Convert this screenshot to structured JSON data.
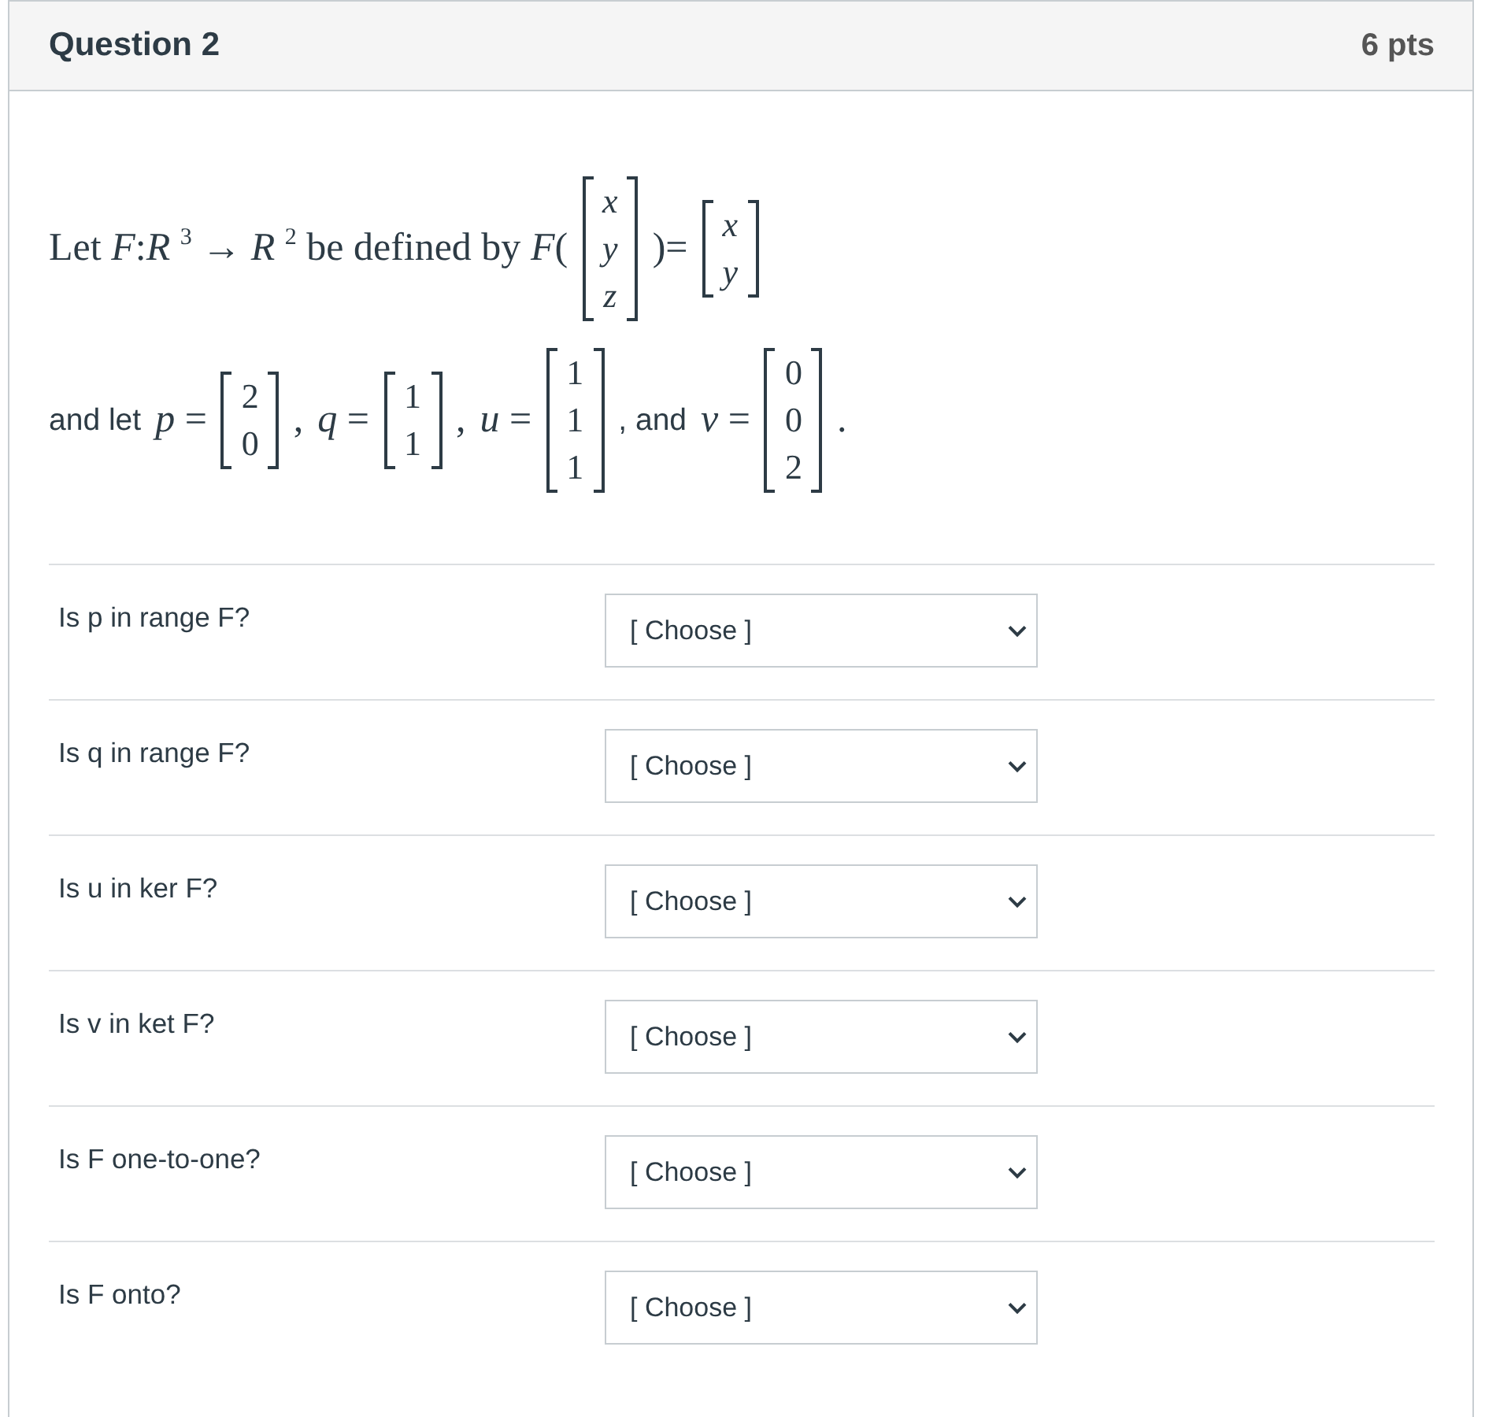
{
  "question": {
    "title": "Question 2",
    "points": "6 pts"
  },
  "statement": [
    [
      {
        "kind": "math",
        "text": "Let *F*:*R* $^{3}$ → *R* $^{2}$ be defined by *F*("
      },
      {
        "kind": "matrix",
        "italic": true,
        "entries": [
          "x",
          "y",
          "z"
        ]
      },
      {
        "kind": "math",
        "text": ")="
      },
      {
        "kind": "matrix",
        "italic": true,
        "entries": [
          "x",
          "y"
        ]
      }
    ],
    [
      {
        "kind": "text",
        "text": "and let"
      },
      {
        "kind": "math",
        "text": "*p* ="
      },
      {
        "kind": "matrix",
        "italic": false,
        "entries": [
          "2",
          "0"
        ]
      },
      {
        "kind": "math",
        "text": ","
      },
      {
        "kind": "math",
        "text": "*q* ="
      },
      {
        "kind": "matrix",
        "italic": false,
        "entries": [
          "1",
          "1"
        ]
      },
      {
        "kind": "math",
        "text": ","
      },
      {
        "kind": "math",
        "text": "*u* ="
      },
      {
        "kind": "matrix",
        "italic": false,
        "entries": [
          "1",
          "1",
          "1"
        ]
      },
      {
        "kind": "text",
        "text": ", and"
      },
      {
        "kind": "math",
        "text": "*v* ="
      },
      {
        "kind": "matrix",
        "italic": false,
        "entries": [
          "0",
          "0",
          "2"
        ]
      },
      {
        "kind": "math",
        "text": "."
      }
    ]
  ],
  "questions": [
    {
      "label": "Is p in range F?",
      "answer": "[ Choose ]"
    },
    {
      "label": "Is q in range F?",
      "answer": "[ Choose ]"
    },
    {
      "label": "Is u in ker F?",
      "answer": "[ Choose ]"
    },
    {
      "label": "Is v in ket F?",
      "answer": "[ Choose ]"
    },
    {
      "label": "Is F one-to-one?",
      "answer": "[ Choose ]"
    },
    {
      "label": "Is F onto?",
      "answer": "[ Choose ]"
    }
  ]
}
